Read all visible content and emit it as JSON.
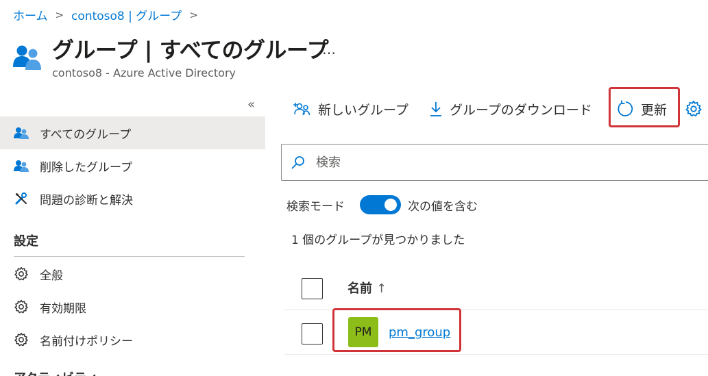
{
  "breadcrumb": {
    "home": "ホーム",
    "tenant_groups": "contoso8 | グループ"
  },
  "header": {
    "title_bold": "グループ",
    "title_rest": " | すべてのグループ",
    "more": "…",
    "subtitle": "contoso8 - Azure Active Directory",
    "icon": "groups-icon"
  },
  "sidebar": {
    "collapse_glyph": "«",
    "items": [
      {
        "label": "すべてのグループ",
        "icon": "group-icon",
        "active": true
      },
      {
        "label": "削除したグループ",
        "icon": "group-icon",
        "active": false
      },
      {
        "label": "問題の診断と解決",
        "icon": "wrench-icon",
        "active": false
      }
    ],
    "settings_heading": "設定",
    "settings_items": [
      {
        "label": "全般",
        "icon": "gear-icon"
      },
      {
        "label": "有効期限",
        "icon": "gear-icon"
      },
      {
        "label": "名前付けポリシー",
        "icon": "gear-icon"
      }
    ],
    "next_heading": "アクティビティ"
  },
  "toolbar": {
    "new_group": "新しいグループ",
    "download": "グループのダウンロード",
    "refresh": "更新"
  },
  "search": {
    "placeholder": "検索"
  },
  "search_mode": {
    "label": "検索モード",
    "toggle_on": true,
    "value": "次の値を含む"
  },
  "results": {
    "count_text": "1 個のグループが見つかりました"
  },
  "table": {
    "column_name": "名前",
    "sort_arrow": "↑",
    "rows": [
      {
        "initials": "PM",
        "name": "pm_group",
        "avatar_color": "#8cbd18"
      }
    ]
  },
  "colors": {
    "accent": "#0078d4",
    "highlight": "#d13438",
    "active_nav_bg": "#edebe9"
  }
}
